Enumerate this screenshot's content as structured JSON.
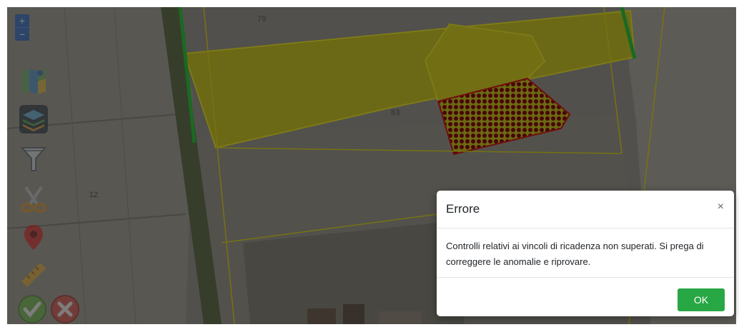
{
  "map": {
    "zoom_in": "+",
    "zoom_out": "−",
    "parcel_labels": [
      "79",
      "83",
      "12"
    ],
    "colors": {
      "selected_area": "#b7b21e",
      "invalid_area": "#8c1414",
      "boundary": "#c8c21d",
      "green_edge": "#2fb53c"
    }
  },
  "toolbar": {
    "tools": [
      "map-icon",
      "layers-icon",
      "filter-icon",
      "scissors-icon",
      "marker-icon",
      "ruler-icon",
      "confirm-icon",
      "cancel-icon"
    ]
  },
  "dialog": {
    "title": "Errore",
    "close": "×",
    "message": "Controlli relativi ai vincoli di ricadenza non superati. Si prega di correggere le anomalie e riprovare.",
    "ok_label": "OK"
  }
}
